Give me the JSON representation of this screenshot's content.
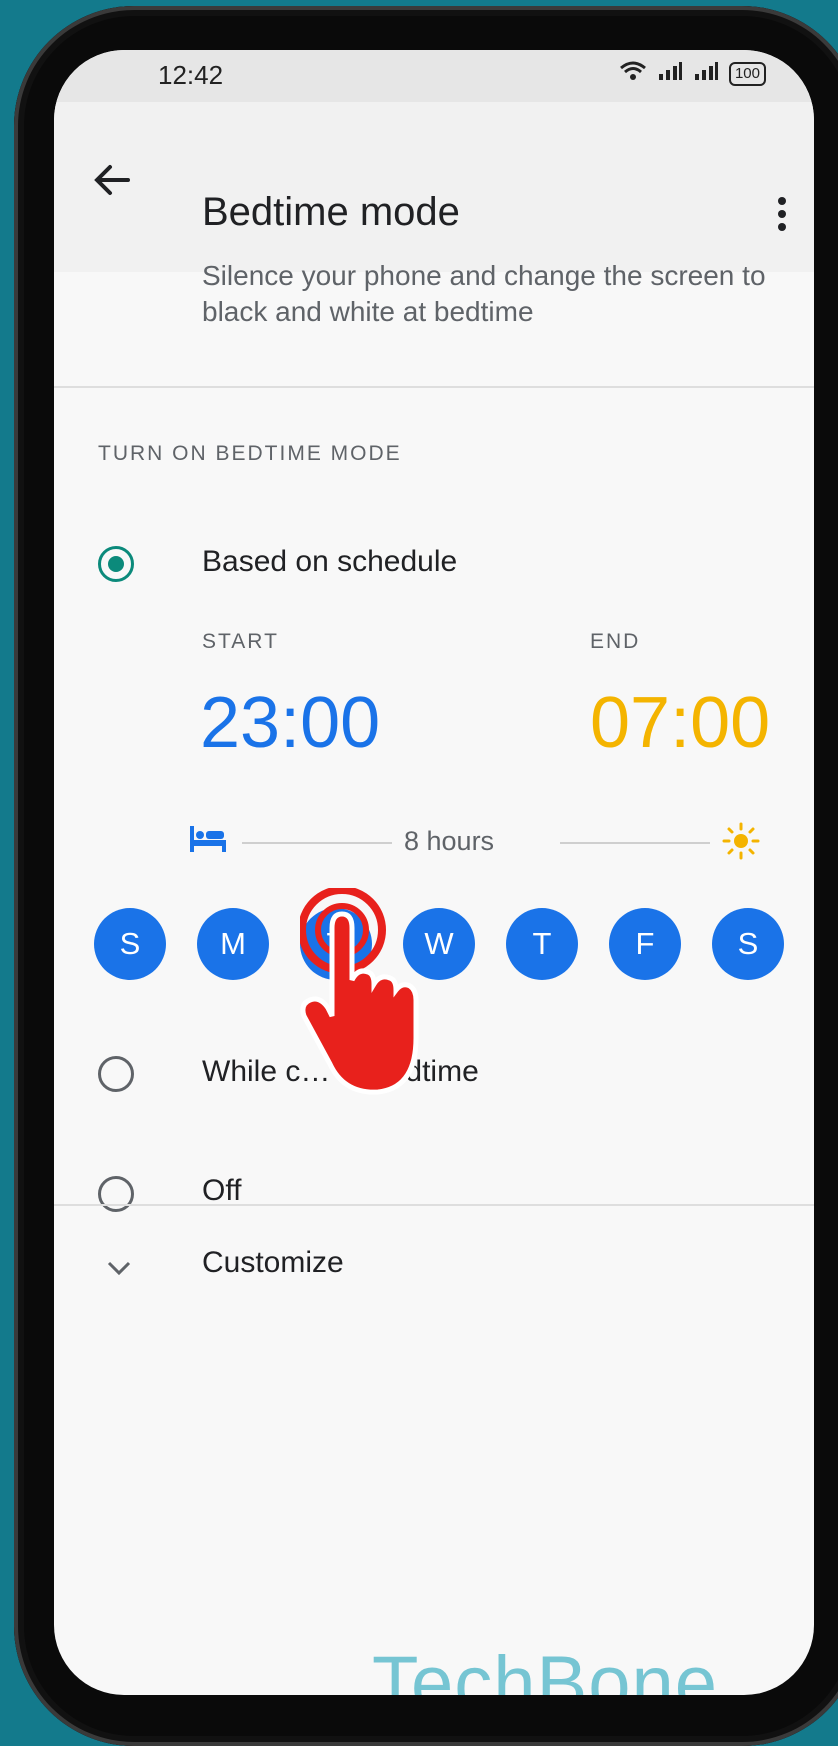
{
  "status_bar": {
    "time": "12:42",
    "battery": "100"
  },
  "appbar": {
    "title": "Bedtime mode"
  },
  "description": "Silence your phone and change the screen to black and white at bedtime",
  "section": {
    "header": "TURN ON BEDTIME MODE"
  },
  "options": [
    {
      "label": "Based on schedule",
      "checked": true
    },
    {
      "label": "While charging at bedtime",
      "visible_label": "While c… at bedtime",
      "checked": false
    },
    {
      "label": "Off",
      "checked": false
    }
  ],
  "schedule": {
    "start_label": "START",
    "end_label": "END",
    "start_time": "23:00",
    "end_time": "07:00",
    "duration": "8 hours",
    "start_color": "#1a73e8",
    "end_color": "#f4b400"
  },
  "days": [
    "S",
    "M",
    "T",
    "W",
    "T",
    "F",
    "S"
  ],
  "customize": {
    "label": "Customize"
  },
  "watermark": "TechBone",
  "colors": {
    "accent_blue": "#1a73e8",
    "radio_teal": "#0b8a7b",
    "tap_red": "#e8211c"
  },
  "icons": [
    "back-arrow-icon",
    "more-vert-icon",
    "bed-icon",
    "sun-icon",
    "chevron-down-icon",
    "tap-hand-icon"
  ]
}
